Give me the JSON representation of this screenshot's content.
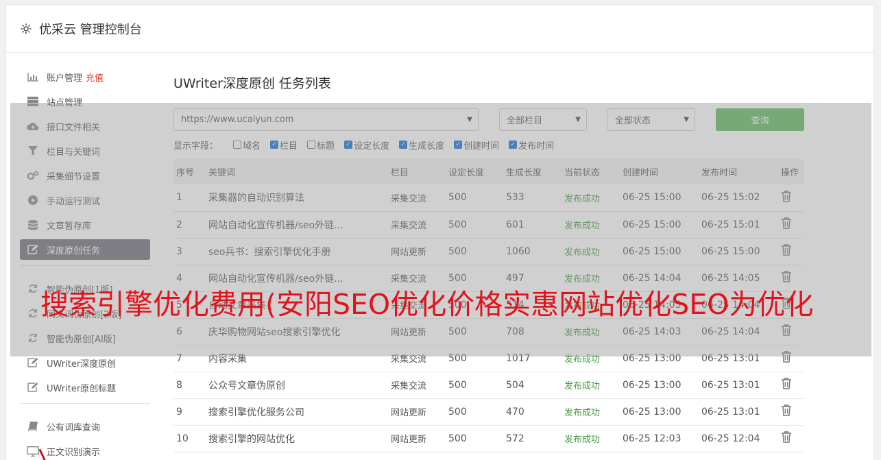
{
  "header": {
    "title": "优采云 管理控制台",
    "icon": "gear-icon"
  },
  "sidebar": {
    "group1": [
      {
        "label": "账户管理",
        "badge": "充值",
        "icon": "bar-chart-icon"
      },
      {
        "label": "站点管理",
        "icon": "server-icon"
      },
      {
        "label": "接口文件相关",
        "icon": "cloud-upload-icon"
      },
      {
        "label": "栏目与关键词",
        "icon": "filter-icon"
      },
      {
        "label": "采集细节设置",
        "icon": "cogs-icon"
      },
      {
        "label": "手动运行测试",
        "icon": "play-icon"
      },
      {
        "label": "文章暂存库",
        "icon": "database-icon"
      },
      {
        "label": "深度原创任务",
        "icon": "edit-icon",
        "active": true
      }
    ],
    "group2": [
      {
        "label": "智能伪原创[1版]",
        "icon": "refresh-icon"
      },
      {
        "label": "同义词伪原创[2版]",
        "icon": "refresh-icon"
      },
      {
        "label": "智能伪原创[AI版]",
        "icon": "refresh-icon"
      },
      {
        "label": "UWriter深度原创",
        "icon": "edit-icon"
      },
      {
        "label": "UWriter原创标题",
        "icon": "edit-icon"
      }
    ],
    "group3": [
      {
        "label": "公有词库查询",
        "icon": "book-icon"
      },
      {
        "label": "正文识别演示",
        "icon": "monitor-icon"
      }
    ]
  },
  "main": {
    "title": "UWriter深度原创 任务列表",
    "site_select": "https://www.ucaiyun.com",
    "column_select": "全部栏目",
    "status_select": "全部状态",
    "query_button": "查询",
    "fields_label": "显示字段：",
    "fields": [
      {
        "label": "域名",
        "checked": false
      },
      {
        "label": "栏目",
        "checked": true
      },
      {
        "label": "标题",
        "checked": false
      },
      {
        "label": "设定长度",
        "checked": true
      },
      {
        "label": "生成长度",
        "checked": true
      },
      {
        "label": "创建时间",
        "checked": true
      },
      {
        "label": "发布时间",
        "checked": true
      }
    ],
    "table": {
      "headers": [
        "序号",
        "关键词",
        "栏目",
        "设定长度",
        "生成长度",
        "当前状态",
        "创建时间",
        "发布时间",
        "操作"
      ],
      "rows": [
        [
          "1",
          "采集器的自动识别算法",
          "采集交流",
          "500",
          "533",
          "发布成功",
          "06-25 15:00",
          "06-25 15:02"
        ],
        [
          "2",
          "网站自动化宣传机器/seo外链...",
          "采集交流",
          "500",
          "601",
          "发布成功",
          "06-25 15:00",
          "06-25 15:01"
        ],
        [
          "3",
          "seo兵书：搜索引擎优化手册",
          "网站更新",
          "500",
          "1060",
          "发布成功",
          "06-25 15:00",
          "06-25 15:00"
        ],
        [
          "4",
          "网站自动化宣传机器/seo外链...",
          "采集交流",
          "500",
          "497",
          "发布成功",
          "06-25 14:04",
          "06-25 14:05"
        ],
        [
          "5",
          "自动文章采集",
          "采集交流",
          "500",
          "514",
          "发布成功",
          "06-25 14:03",
          "06-25 14:04"
        ],
        [
          "6",
          "庆华购物网站seo搜索引擎优化",
          "网站更新",
          "500",
          "708",
          "发布成功",
          "06-25 14:03",
          "06-25 14:04"
        ],
        [
          "7",
          "内容采集",
          "采集交流",
          "500",
          "1017",
          "发布成功",
          "06-25 13:00",
          "06-25 13:01"
        ],
        [
          "8",
          "公众号文章伪原创",
          "采集交流",
          "500",
          "504",
          "发布成功",
          "06-25 13:00",
          "06-25 13:01"
        ],
        [
          "9",
          "搜索引擎优化服务公司",
          "网站更新",
          "500",
          "470",
          "发布成功",
          "06-25 13:00",
          "06-25 13:01"
        ],
        [
          "10",
          "搜索引擎的网站优化",
          "网站更新",
          "500",
          "572",
          "发布成功",
          "06-25 12:03",
          "06-25 12:04"
        ]
      ]
    }
  },
  "banner": {
    "text": "搜索引擎优化费用(安阳SEO优化价格实惠网站优化SEO为优化"
  }
}
